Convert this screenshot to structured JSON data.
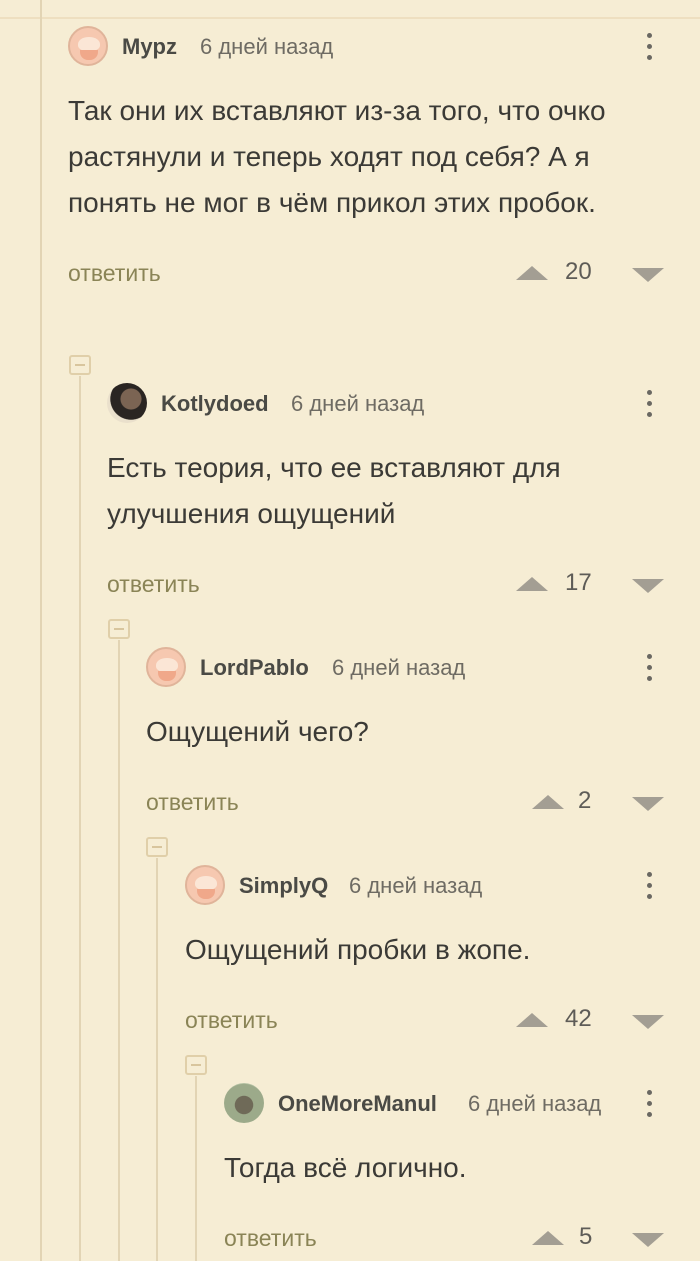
{
  "reply_label": "ответить",
  "comments": [
    {
      "author": "Mypz",
      "time": "6 дней назад",
      "text": "Так они их вставляют из-за того, что очко растянули и теперь ходят под себя? А я понять не мог в чём прикол этих пробок.",
      "rating": "20",
      "avatar": "default-avatar"
    },
    {
      "author": "Kotlydoed",
      "time": "6 дней назад",
      "text": "Есть теория, что ее вставляют для улучшения ощущений",
      "rating": "17",
      "avatar": "photo-avatar"
    },
    {
      "author": "LordPablo",
      "time": "6 дней назад",
      "text": "Ощущений чего?",
      "rating": "2",
      "avatar": "default-avatar"
    },
    {
      "author": "SimplyQ",
      "time": "6 дней назад",
      "text": "Ощущений пробки в жопе.",
      "rating": "42",
      "avatar": "default-avatar"
    },
    {
      "author": "OneMoreManul",
      "time": "6 дней назад",
      "text": "Тогда всё логично.",
      "rating": "5",
      "avatar": "photo-avatar"
    }
  ],
  "colors": {
    "background": "#f6edd4",
    "reply_link": "#8a8456",
    "thread_line": "#e2d4b4"
  }
}
